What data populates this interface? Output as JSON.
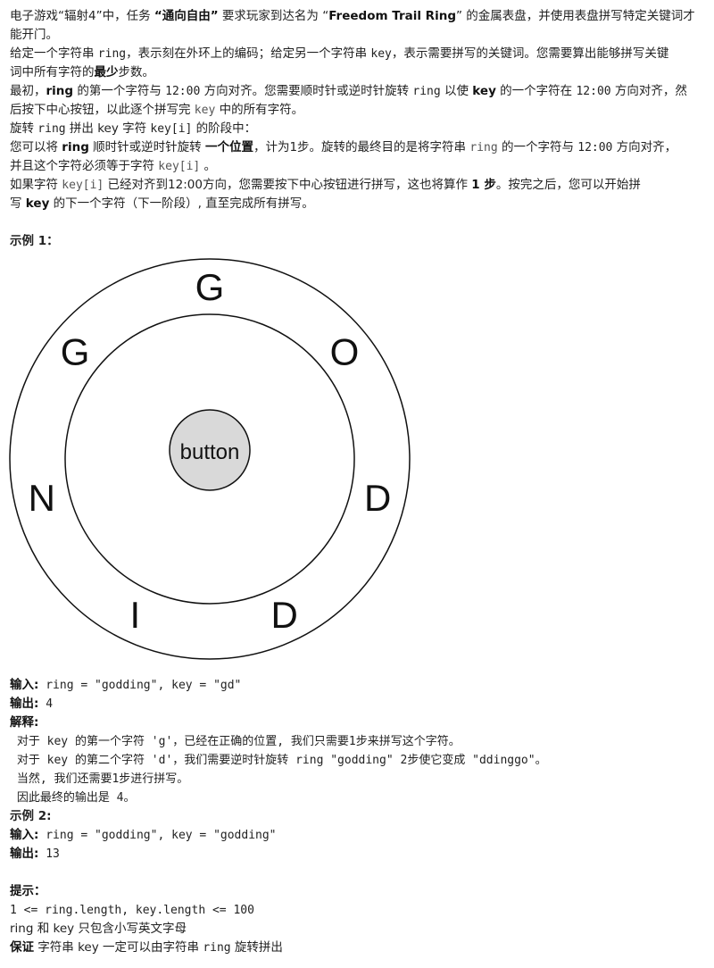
{
  "intro": {
    "p1_a": "电子游戏“辐射4”中，任务 ",
    "p1_b": "“通向自由”",
    "p1_c": " 要求玩家到达名为 “",
    "p1_d": "Freedom Trail Ring",
    "p1_e": "” 的金属表盘，并使用表盘拼写特定关键词才",
    "p1_f": "能开门。",
    "p2_a": "给定一个字符串 ",
    "p2_b": "ring",
    "p2_c": "，表示刻在外环上的编码；给定另一个字符串 ",
    "p2_d": "key",
    "p2_e": "，表示需要拼写的关键词。您需要算出能够拼写关键",
    "p2_f": "词中所有字符的",
    "p2_g": "最少",
    "p2_h": "步数。",
    "p3_a": "最初，",
    "p3_b": "ring",
    "p3_c": " 的第一个字符与 ",
    "p3_d": "12:00",
    "p3_e": " 方向对齐。您需要顺时针或逆时针旋转 ",
    "p3_f": "ring",
    "p3_g": " 以使 ",
    "p3_h": "key",
    "p3_i": " 的一个字符在 ",
    "p3_j": "12:00",
    "p3_k": " 方向对齐，然",
    "p3_l": "后按下中心按钮，以此逐个拼写完 ",
    "p3_m": "key",
    "p3_n": " 中的所有字符。",
    "p4_a": "旋转 ",
    "p4_b": "ring",
    "p4_c": " 拼出 key 字符 ",
    "p4_d": "key[i]",
    "p4_e": " 的阶段中：",
    "p5_a": "您可以将 ",
    "p5_b": "ring",
    "p5_c": " 顺时针或逆时针旋转 ",
    "p5_d": "一个位置",
    "p5_e": "，计为1步。旋转的最终目的是将字符串 ",
    "p5_f": "ring",
    "p5_g": " 的一个字符与 ",
    "p5_h": "12:00",
    "p5_i": " 方向对齐，",
    "p5_j": "并且这个字符必须等于字符 ",
    "p5_k": "key[i]",
    "p5_l": " 。",
    "p6_a": "如果字符 ",
    "p6_b": "key[i]",
    "p6_c": " 已经对齐到12:00方向，您需要按下中心按钮进行拼写，这也将算作 ",
    "p6_d": "1 步",
    "p6_e": "。按完之后，您可以开始拼",
    "p6_f": "写 ",
    "p6_g": "key",
    "p6_h": " 的下一个字符（下一阶段）, 直至完成所有拼写。"
  },
  "example1": {
    "title": "示例 1：",
    "ring_letters": [
      "G",
      "O",
      "D",
      "D",
      "I",
      "N",
      "G"
    ],
    "button_label": "button",
    "input_label": "输入:",
    "input_value": " ring = \"godding\", key = \"gd\"",
    "output_label": "输出:",
    "output_value": " 4",
    "explain_label": "解释:",
    "explain_lines": [
      " 对于 key 的第一个字符 'g'，已经在正确的位置, 我们只需要1步来拼写这个字符。",
      " 对于 key 的第二个字符 'd'，我们需要逆时针旋转 ring \"godding\" 2步使它变成 \"ddinggo\"。",
      " 当然, 我们还需要1步进行拼写。",
      " 因此最终的输出是 4。"
    ]
  },
  "example2": {
    "title": "示例 2:",
    "input_label": "输入:",
    "input_value": " ring = \"godding\", key = \"godding\"",
    "output_label": "输出:",
    "output_value": " 13"
  },
  "hints": {
    "title": "提示：",
    "line1": "1 <= ring.length, key.length <= 100",
    "line2_a": "ring",
    "line2_b": " 和 ",
    "line2_c": "key",
    "line2_d": " 只包含小写英文字母",
    "line3_a": "保证",
    "line3_b": " 字符串 ",
    "line3_c": "key",
    "line3_d": " 一定可以由字符串 ",
    "line3_e": "ring",
    "line3_f": " 旋转拼出"
  }
}
